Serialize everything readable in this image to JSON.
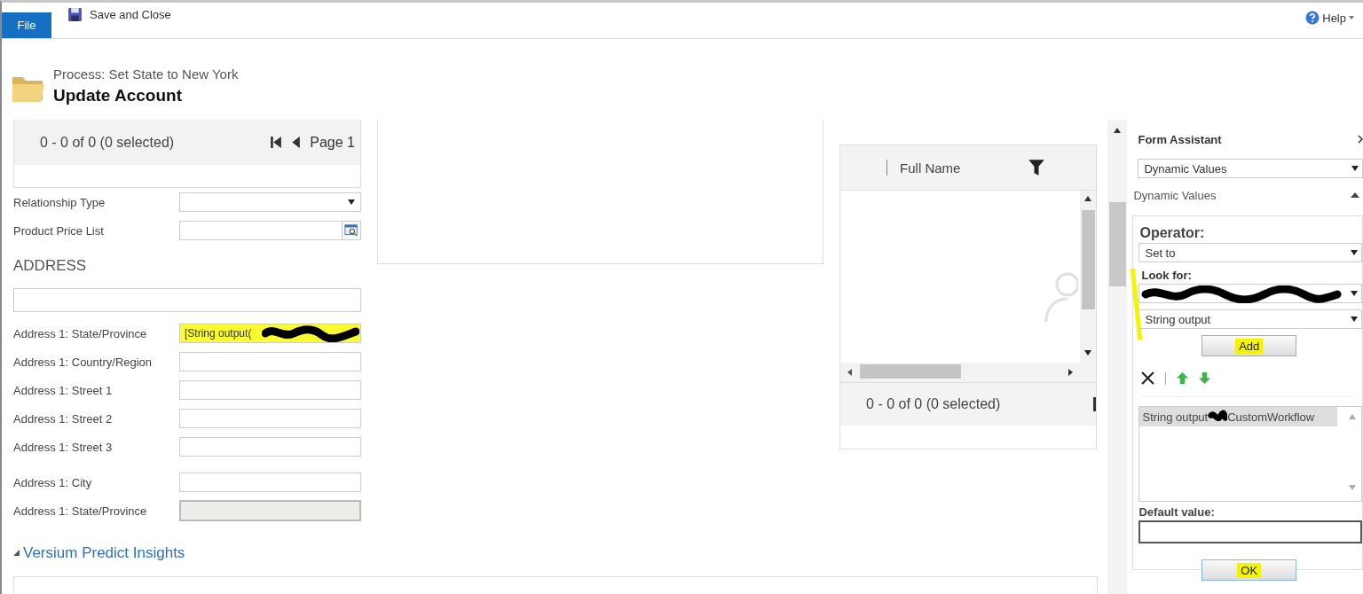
{
  "ribbon": {
    "file_tab": "File",
    "save": "Save and Close",
    "help": "Help"
  },
  "header": {
    "process": "Process: Set State to New York",
    "title": "Update Account"
  },
  "subgrid": {
    "count": "0 - 0 of 0 (0 selected)",
    "page": "Page 1"
  },
  "fields": [
    {
      "label": "Relationship Type",
      "kind": "select"
    },
    {
      "label": "Product Price List",
      "kind": "lookup"
    }
  ],
  "address": {
    "heading": "ADDRESS",
    "fields": [
      {
        "kind": "wide",
        "highlighted": false,
        "disabled": false,
        "redacted": false
      },
      {
        "kind": "text",
        "label": "Address 1: State/Province",
        "value": "[String output(",
        "highlighted": true,
        "disabled": false,
        "redacted": true
      },
      {
        "kind": "text",
        "label": "Address 1: Country/Region",
        "highlighted": false,
        "disabled": false,
        "redacted": false
      },
      {
        "kind": "text",
        "label": "Address 1: Street 1",
        "highlighted": false,
        "disabled": false,
        "redacted": false
      },
      {
        "kind": "text",
        "label": "Address 1: Street 2",
        "highlighted": false,
        "disabled": false,
        "redacted": false
      },
      {
        "kind": "text",
        "label": "Address 1: Street 3",
        "highlighted": false,
        "disabled": false,
        "redacted": false
      },
      {
        "kind": "text",
        "label": "Address 1: City",
        "highlighted": false,
        "disabled": false,
        "redacted": false
      },
      {
        "kind": "text",
        "label": "Address 1: State/Province",
        "highlighted": false,
        "disabled": true,
        "redacted": false
      }
    ]
  },
  "section": {
    "title": "Versium Predict Insights",
    "expanded": true
  },
  "contacts_grid": {
    "column": "Full Name",
    "count": "0 - 0 of 0 (0 selected)"
  },
  "form_assistant": {
    "title": "Form Assistant",
    "mode": "Dynamic Values",
    "section": "Dynamic Values",
    "expanded": true,
    "operator_label": "Operator:",
    "operator": "Set to",
    "look_for_label": "Look for:",
    "look_for_marked": true,
    "entity_redacted": true,
    "attribute": "String output",
    "add": {
      "label": "Add",
      "highlighted": true
    },
    "list_items": [
      {
        "text": "String output",
        "after": "CustomWorkflow",
        "redacted": true,
        "selected": true
      }
    ],
    "default_label": "Default value:",
    "ok": {
      "label": "OK",
      "highlighted": true
    }
  }
}
